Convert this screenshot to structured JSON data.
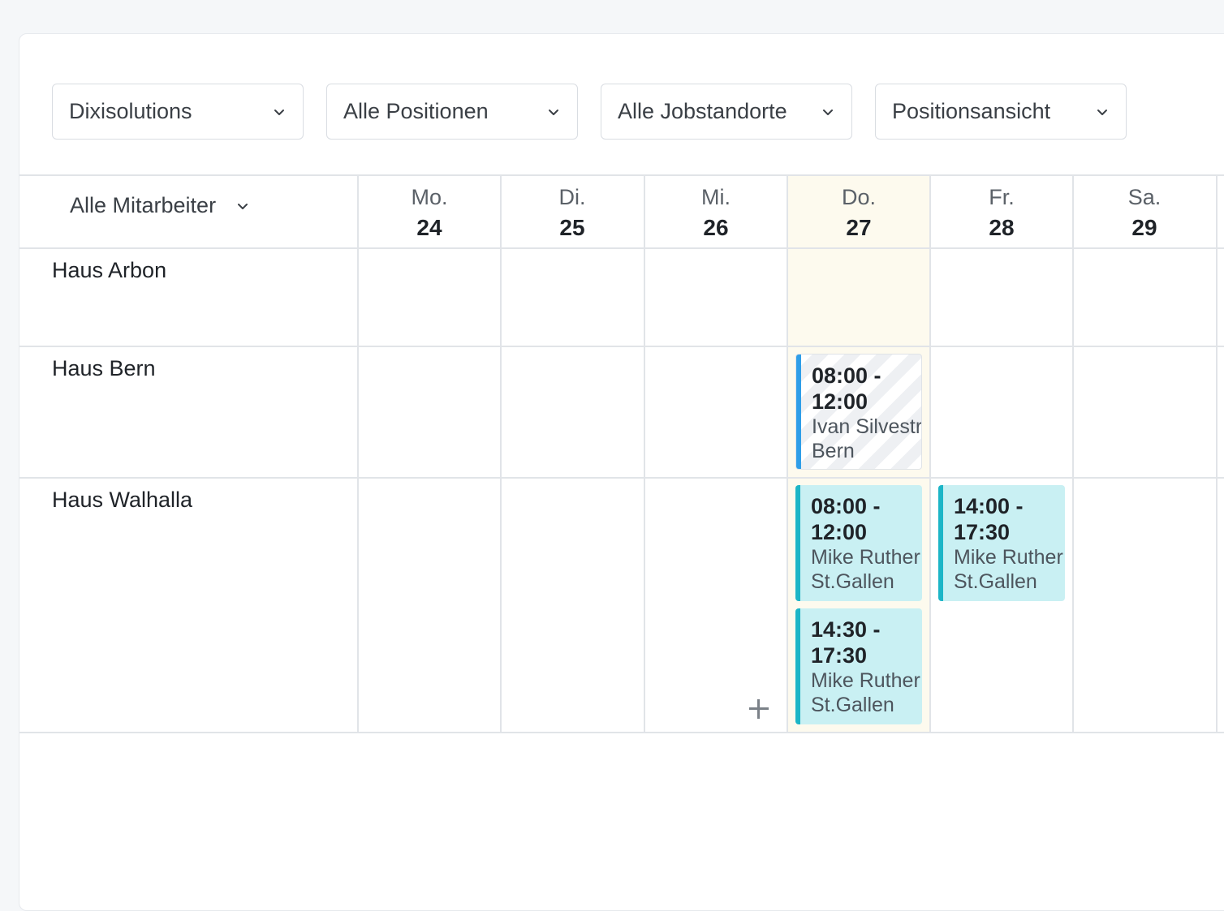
{
  "filters": {
    "company": "Dixisolutions",
    "positions": "Alle Positionen",
    "locations": "Alle Jobstandorte",
    "view": "Positionsansicht"
  },
  "employees_filter": "Alle Mitarbeiter",
  "days": [
    {
      "name": "Mo.",
      "date": "24"
    },
    {
      "name": "Di.",
      "date": "25"
    },
    {
      "name": "Mi.",
      "date": "26"
    },
    {
      "name": "Do.",
      "date": "27"
    },
    {
      "name": "Fr.",
      "date": "28"
    },
    {
      "name": "Sa.",
      "date": "29"
    }
  ],
  "rows": [
    {
      "label": "Haus Arbon"
    },
    {
      "label": "Haus Bern"
    },
    {
      "label": "Haus Walhalla"
    }
  ],
  "shifts": [
    {
      "time_start": "08:00 -",
      "time_end": "12:00",
      "person": "Ivan Silvestri",
      "location": "Bern",
      "style": "draft"
    },
    {
      "time_start": "08:00 -",
      "time_end": "12:00",
      "person": "Mike Ruther",
      "location": "St.Gallen",
      "style": "teal"
    },
    {
      "time_start": "14:30 -",
      "time_end": "17:30",
      "person": "Mike Ruther",
      "location": "St.Gallen",
      "style": "teal"
    },
    {
      "time_start": "14:00 -",
      "time_end": "17:30",
      "person": "Mike Ruther",
      "location": "St.Gallen",
      "style": "teal"
    }
  ],
  "colors": {
    "today_background": "#fdfaee",
    "shift_teal": "#c9f0f3",
    "shift_teal_bar": "#1cb5c7",
    "shift_draft_bar": "#2f9ee8"
  },
  "icons": [
    "chevron-down-icon",
    "plus-icon"
  ]
}
